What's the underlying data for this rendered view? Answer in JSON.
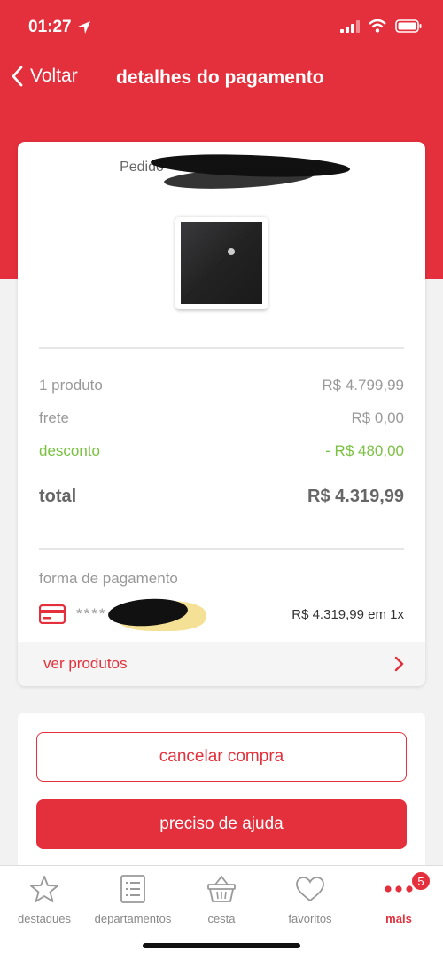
{
  "status_bar": {
    "time": "01:27"
  },
  "nav": {
    "back_label": "Voltar",
    "title": "detalhes do pagamento"
  },
  "order": {
    "label": "Pedido",
    "summary": {
      "products_label": "1 produto",
      "products_value": "R$ 4.799,99",
      "shipping_label": "frete",
      "shipping_value": "R$ 0,00",
      "discount_label": "desconto",
      "discount_value": "- R$ 480,00",
      "total_label": "total",
      "total_value": "R$ 4.319,99"
    },
    "payment": {
      "label": "forma de pagamento",
      "card_mask": "****",
      "amount": "R$ 4.319,99 em 1x"
    },
    "view_products_label": "ver produtos"
  },
  "actions": {
    "cancel_label": "cancelar compra",
    "help_label": "preciso de ajuda"
  },
  "tabbar": {
    "items": [
      {
        "label": "destaques",
        "icon": "star-icon"
      },
      {
        "label": "departamentos",
        "icon": "list-icon"
      },
      {
        "label": "cesta",
        "icon": "basket-icon"
      },
      {
        "label": "favoritos",
        "icon": "heart-icon"
      },
      {
        "label": "mais",
        "icon": "more-icon",
        "badge": "5"
      }
    ]
  },
  "colors": {
    "brand": "#e3303c",
    "discount": "#7ac142"
  }
}
